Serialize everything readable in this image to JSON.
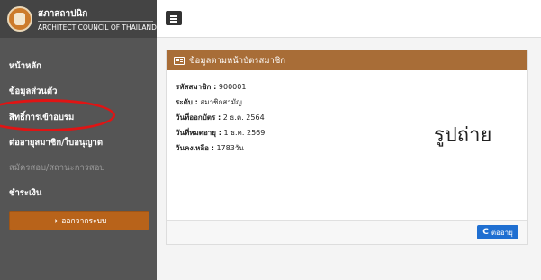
{
  "brand": {
    "title": "สภาสถาปนิก",
    "subtitle": "ARCHITECT COUNCIL OF THAILAND"
  },
  "sidebar": {
    "items": [
      {
        "label": "หน้าหลัก"
      },
      {
        "label": "ข้อมูลส่วนตัว"
      },
      {
        "label": "สิทธิ์การเข้าอบรม"
      },
      {
        "label": "ต่ออายุสมาชิก/ใบอนุญาต"
      },
      {
        "label": "สมัครสอบ/สถานะการสอบ"
      },
      {
        "label": "ชำระเงิน"
      }
    ],
    "logout_label": "ออกจากระบบ"
  },
  "card": {
    "title": "ข้อมูลตามหน้าบัตรสมาชิก",
    "rows": [
      {
        "label": "รหัสสมาชิก :",
        "value": "900001"
      },
      {
        "label": "ระดับ :",
        "value": "สมาชิกสามัญ"
      },
      {
        "label": "วันที่ออกบัตร :",
        "value": "2 ธ.ค. 2564"
      },
      {
        "label": "วันที่หมดอายุ :",
        "value": "1 ธ.ค. 2569"
      },
      {
        "label": "วันคงเหลือ :",
        "value": "1783วัน"
      }
    ],
    "photo_placeholder": "รูปถ่าย",
    "renew_label": "ต่ออายุ"
  },
  "colors": {
    "sidebar_bg": "#555555",
    "card_header": "#a86d37",
    "logout_btn": "#b8631a",
    "renew_btn": "#1f6fd1",
    "annotation": "#e01414"
  }
}
